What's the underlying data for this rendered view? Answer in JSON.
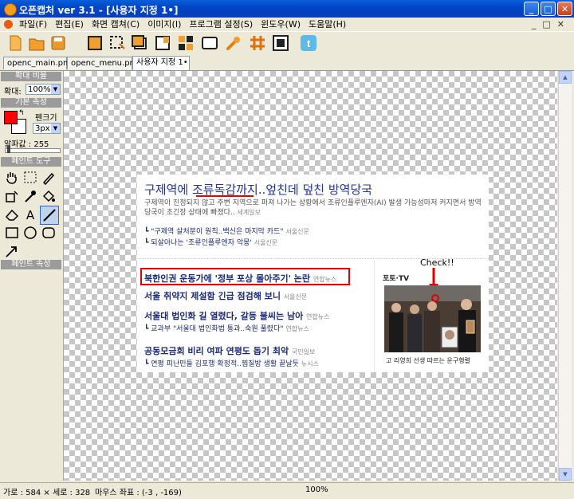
{
  "window": {
    "title": "오픈캡처 ver 3.1 - [사용자 지정 1•]"
  },
  "menu": [
    "파일(F)",
    "편집(E)",
    "화면 캡쳐(C)",
    "이미지(I)",
    "프로그램 설정(S)",
    "윈도우(W)",
    "도움말(H)"
  ],
  "toolbar_icons": [
    "new-icon",
    "open-icon",
    "save-icon",
    "capture-screen-icon",
    "capture-region-icon",
    "capture-window-icon",
    "capture-scroll-icon",
    "capture-object-icon",
    "capture-fullscreen-icon",
    "eyedropper-icon",
    "ruler-grid-icon",
    "capture-fixed-icon",
    "twitter-icon"
  ],
  "tabs": [
    "openc_main.png",
    "openc_menu.png",
    "사용자 지정 1•"
  ],
  "panel": {
    "zoom_header": "확대 비율",
    "zoom_label": "확대:",
    "zoom_value": "100%",
    "basic_header": "기본 속성",
    "pen_label": "펜크기",
    "pen_value": "3px",
    "alpha_label": "알파값 : 255",
    "alpha_level": 1.0,
    "paint_header": "페인트 도구",
    "paint_attr_header": "페인트 속성",
    "fg_color": "#ff0000",
    "bg_color": "#ffffff"
  },
  "statusbar": {
    "size": "가로 : 584 × 세로 : 328",
    "mouse": "마우스 좌표 : (-3 , -169)",
    "zoom": "100%"
  },
  "capture": {
    "headline": "구제역에 조류독감까지..엎친데 덮친 방역당국",
    "summary": "구제역이 진정되지 않고 주변 지역으로 퍼져 나가는 상황에서 조류인플루엔자(AI) 발생 가능성마저 커지면서 방역 당국이 초긴장 상태에 빠졌다..",
    "summary_src": "세계일보",
    "related": [
      {
        "text": "\"구제역 살처분이 원칙..백신은 마지막 카드\"",
        "src": "서울신문"
      },
      {
        "text": "되살아나는 '조류인플루엔자 악몽'",
        "src": "서울신문"
      }
    ],
    "news": [
      {
        "text": "북한인권 운동가에 '정부 포상 몰아주기' 논란",
        "src": "연합뉴스"
      },
      {
        "text": "서울 취약지 제설함 긴급 점검해 보니",
        "src": "서울신문"
      },
      {
        "text": "서울대 법인화 길 열렸다, 갈등 불씨는 남아",
        "src": "연합뉴스"
      },
      {
        "text": "교과부 \"서울대 법인화법 통과..숙원 풀렸다\"",
        "src": "연합뉴스"
      },
      {
        "text": "공동모금회 비리 여파 연평도 돕기 최악",
        "src": "국민일보"
      },
      {
        "text": "연평 피난민들 김포행 확정적..찜질방 생활 끝날듯",
        "src": "뉴시스"
      }
    ],
    "photo_label": "포토·TV",
    "photo_caption": "고 리영희 선생 따르는 운구행렬",
    "annotation": "Check!!"
  }
}
